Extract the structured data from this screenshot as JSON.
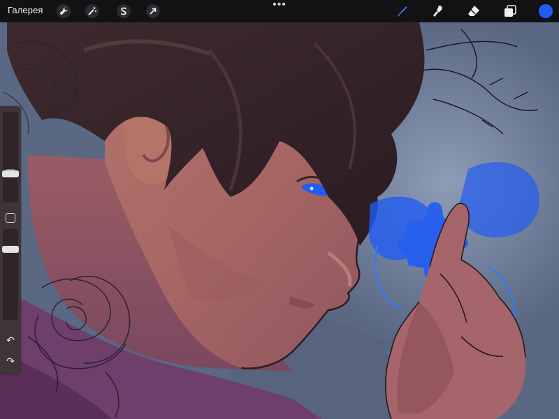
{
  "toolbar": {
    "gallery_label": "Галерея",
    "left_tools": [
      {
        "name": "actions",
        "icon": "wrench-icon"
      },
      {
        "name": "adjustments",
        "icon": "magic-wand-icon"
      },
      {
        "name": "selection",
        "icon": "selection-s-icon"
      },
      {
        "name": "transform",
        "icon": "cursor-arrow-icon"
      }
    ],
    "more_label": "•••",
    "right_tools": [
      {
        "name": "brush",
        "icon": "brush-icon",
        "active": true
      },
      {
        "name": "smudge",
        "icon": "smudge-icon"
      },
      {
        "name": "eraser",
        "icon": "eraser-icon"
      },
      {
        "name": "layers",
        "icon": "layers-icon"
      }
    ],
    "active_color": "#1f5cf6",
    "active_tool_color": "#2f7bff"
  },
  "sidebar": {
    "brush_size_level": 0.3,
    "opacity_level": 0.8,
    "undo_label": "↶",
    "redo_label": "↷"
  },
  "canvas": {
    "background_color": "#5d6b85",
    "accent_color": "#1f5cf6"
  }
}
